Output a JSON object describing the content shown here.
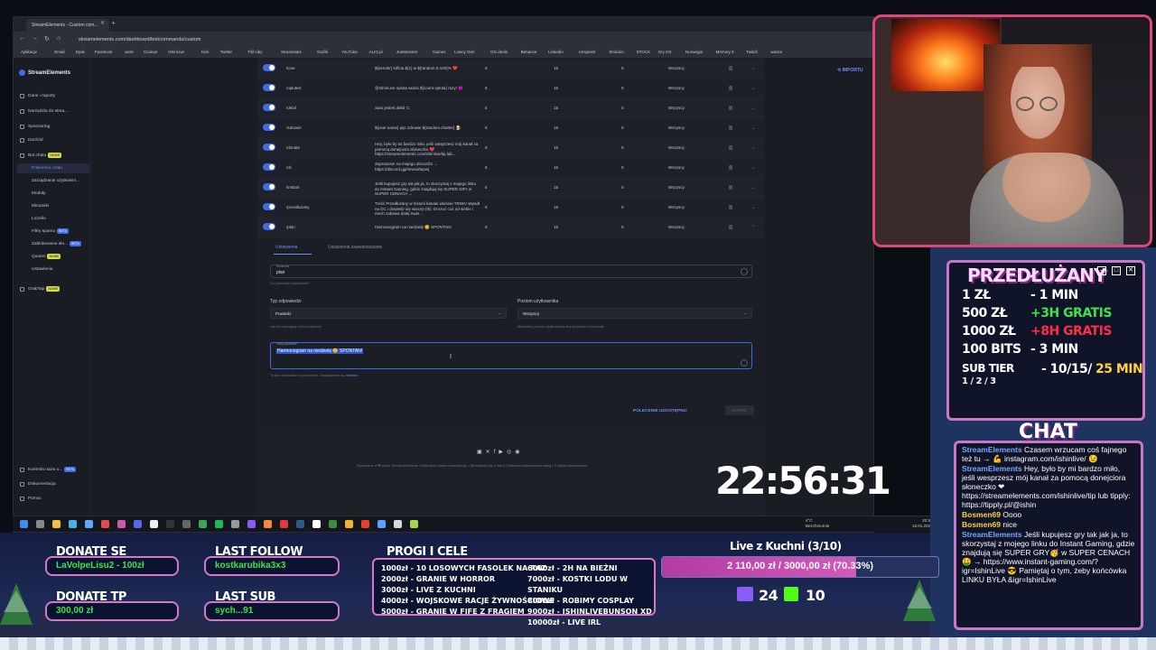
{
  "browser": {
    "tab_title": "StreamElements - Custom com...",
    "url": "streamelements.com/dashboard/bot/commands/custom",
    "bookmarks": [
      "Aplikacje",
      "Gmail",
      "Dysk",
      "Facebook",
      "work",
      "Ocukus",
      "IshinLive",
      "Kick",
      "Twitter",
      "Tikł niby",
      "Streamlabs",
      "Grafik",
      "YouTube",
      "ALIO.pl",
      "JoeMonster",
      "Games",
      "Lowcy Gier",
      "GG.deals",
      "Behance",
      "Linkedin",
      "Unsplash",
      "Shindon",
      "STOCK",
      "Gry tmt",
      "Norwegia",
      "Memory 5",
      "Twitch",
      "wasze"
    ]
  },
  "sidebar": {
    "brand": "StreamElements",
    "items": [
      {
        "label": "Dane i raporty"
      },
      {
        "label": "Narzędzia do strea..."
      },
      {
        "label": "Sponsoring"
      },
      {
        "label": "Dochód"
      },
      {
        "label": "Bot chatu",
        "badge": "NOWE"
      },
      {
        "label": "Polecenia czatu"
      },
      {
        "label": "Zarządzanie użytkowni..."
      },
      {
        "label": "Moduły"
      },
      {
        "label": "Minutniki"
      },
      {
        "label": "Liczniki"
      },
      {
        "label": "Filtry spamu",
        "badge": "BETA"
      },
      {
        "label": "Zablokowane sło...",
        "badge": "BETA"
      },
      {
        "label": "Quotes",
        "badge": "NOWE"
      },
      {
        "label": "Ustawienia"
      },
      {
        "label": "GrabTap",
        "badge": "NOWE"
      },
      {
        "label": "Kontrola nazw u...",
        "badge": "BETA"
      },
      {
        "label": "Dokumentacja"
      },
      {
        "label": "Pomoc"
      }
    ]
  },
  "import_label": "IMPORTU",
  "commands": [
    {
      "name": "!love",
      "response": "${sender} loffcia ${1} w ${random.0-100}% ❤️",
      "c1": "5",
      "c2": "15",
      "c3": "0",
      "level": "Wszyscy"
    },
    {
      "name": "!opluted",
      "response": "@IshinLive opluta widza ${count opluta} razy! 😈",
      "c1": "5",
      "c2": "15",
      "c3": "0",
      "level": "Wszyscy"
    },
    {
      "name": "!debil",
      "response": "Sam jesteś debil :C",
      "c1": "5",
      "c2": "15",
      "c3": "0",
      "level": "Wszyscy"
    },
    {
      "name": "!zdrowie",
      "response": "${user.name} pije zdrowie ${random.chatter} 🍺",
      "c1": "5",
      "c2": "15",
      "c3": "0",
      "level": "Wszyscy"
    },
    {
      "name": "!donate",
      "response": "Hey, było by mi bardzo miło, jeśli wesprzesz mój kanał za pomocą donejciora słoneczko ❤️ https://streamelements.com/ishinlive/tip lab...",
      "c1": "5",
      "c2": "15",
      "c3": "0",
      "level": "Wszyscy"
    },
    {
      "name": "!dc",
      "response": "Zapraszam na mojego discord'a → https://discord.gg/riewcahkpwj",
      "c1": "5",
      "c2": "15",
      "c3": "0",
      "level": "Wszyscy"
    },
    {
      "name": "!instant",
      "response": "Jeśli kupujesz gry tak jak ja, to skorzystaj z mojego linku do Instant Gaming, gdzie znajdują się SUPER GRY w SUPER CENACH →",
      "c1": "5",
      "c2": "15",
      "c3": "0",
      "level": "Wszyscy"
    },
    {
      "name": "!przedłużany",
      "response": "Treść Przedłużany w historii kanału włośnie TRWA! Wpadł na DC i dowiedz się więcej! (tk). Dorzuć coś od siebie i niech zabawa dalej trwa!...",
      "c1": "5",
      "c2": "15",
      "c3": "0",
      "level": "Wszyscy"
    },
    {
      "name": "!plan",
      "response": "Harmonogram na niedzielę 😊 SPONTAN!",
      "c1": "5",
      "c2": "15",
      "c3": "0",
      "level": "Wszyscy"
    }
  ],
  "editor": {
    "tab_settings": "Ustawienia",
    "tab_advanced": "Ustawienia zaawansowane",
    "command_label": "Komenda",
    "command_value": "plan",
    "command_hint": "Co powoduje odpowiedź?",
    "type_label": "Typ odpowiedzi",
    "type_value": "Powiedz",
    "type_hint": "Jak bot zareaguje na to polecenie",
    "level_label": "Poziom użytkownika",
    "level_value": "Wszyscy",
    "level_hint": "Minimalny poziom użytkownika aby korzystać z komendy",
    "response_label": "Twój odpowiedź",
    "response_value": "Harmonogram na niedzielę 😊 SPONTAN!",
    "response_hint": "To jest odpowiedź na polecenie. Obsługiwane są",
    "response_hint_link": "zmienne",
    "share_button": "POLECENIE UDOSTĘPNIJ",
    "save_button": "ZAPISZ"
  },
  "footer": {
    "social": "     ",
    "text": "Wykonane z ❤ przez StreamElements • Wsparcie prawa autorskiego • Skontaktuj się z nami • Warunki świadczenia usług • Polityka prywatności"
  },
  "taskbar": {
    "temp": "4°C",
    "weather": "Bezchmurnie",
    "time": "22:56",
    "date": "18.01.2026"
  },
  "clock": "22:56:31",
  "prices": {
    "title": "PRZEDŁUŻANY",
    "lines": [
      {
        "left": "1 ZŁ",
        "right": "- 1 MIN",
        "extra": ""
      },
      {
        "left": "500 ZŁ",
        "right": "",
        "extra": "+3H GRATIS"
      },
      {
        "left": "1000 ZŁ",
        "right": "",
        "extra": "+8H GRATIS"
      },
      {
        "left": "100 BITS",
        "right": "- 3 MIN",
        "extra": ""
      },
      {
        "left": "SUB TIER",
        "right": "- 10/15/",
        "extra": "25 MIN"
      }
    ],
    "tier_sub": "1 / 2 / 3"
  },
  "chat": {
    "title": "CHAT",
    "messages": [
      {
        "user": "StreamElements",
        "text": "Czasem wrzucam coś fajnego też tu → 💪 instagram.com/ishinlive/ 😉"
      },
      {
        "user": "StreamElements",
        "text": "Hey, było by mi bardzo miło, jeśli wesprzesz mój kanał za pomocą donejciora słoneczko ❤ https://streamelements.com/ishinlive/tip lub tipply: https://tipply.pl/@ishin"
      },
      {
        "user": "Bosmen69",
        "text": "Oooo"
      },
      {
        "user": "Bosmen69",
        "text": "nice"
      },
      {
        "user": "StreamElements",
        "text": "Jeśli kupujesz gry tak jak ja, to skorzystaj z mojego linku do Instant Gaming, gdzie znajdują się SUPER GRY🥳 w SUPER CENACH 🤑 → https://www.instant-gaming.com/?igr=IshinLive 😎 Pamiętaj o tym, żeby końcówka LINKU BYŁA &igr=IshinLive"
      }
    ]
  },
  "bottom": {
    "donate_title": "DONATE SE",
    "donate_value": "LaVolpeLisu2 - 100zł",
    "follow_title": "LAST FOLLOW",
    "follow_value": "kostkarubika3x3",
    "topdonate_title": "DONATE TP",
    "topdonate_value": "300,00 zł",
    "sub_title": "LAST SUB",
    "sub_value": "sych...91",
    "goals_title": "PROGI I CELE",
    "goals_left": [
      "1000zł - 10 LOSOWYCH FASOLEK NA RAZ",
      "2000zł - GRANIE W HORROR",
      "3000zł - LIVE Z KUCHNI",
      "4000zł - WOJSKOWE RACJE ŻYWNOŚCIOWE",
      "5000zł - GRANIE W FIFE Z FRAGIEM"
    ],
    "goals_right": [
      "6000zł - 2H NA BIEŻNI",
      "7000zł - KOSTKI LODU W STANIKU",
      "8000zł - ROBIMY COSPLAY",
      "9000zł - ISHINLIVEBUNSON XD",
      "10000zł - LIVE IRL"
    ],
    "goal_title": "Live z Kuchni (3/10)",
    "goal_progress": "2 110,00 zł / 3000,00 zł (70.33%)",
    "goal_fraction": 0.7033,
    "twitch_count": "24",
    "kick_count": "10"
  }
}
